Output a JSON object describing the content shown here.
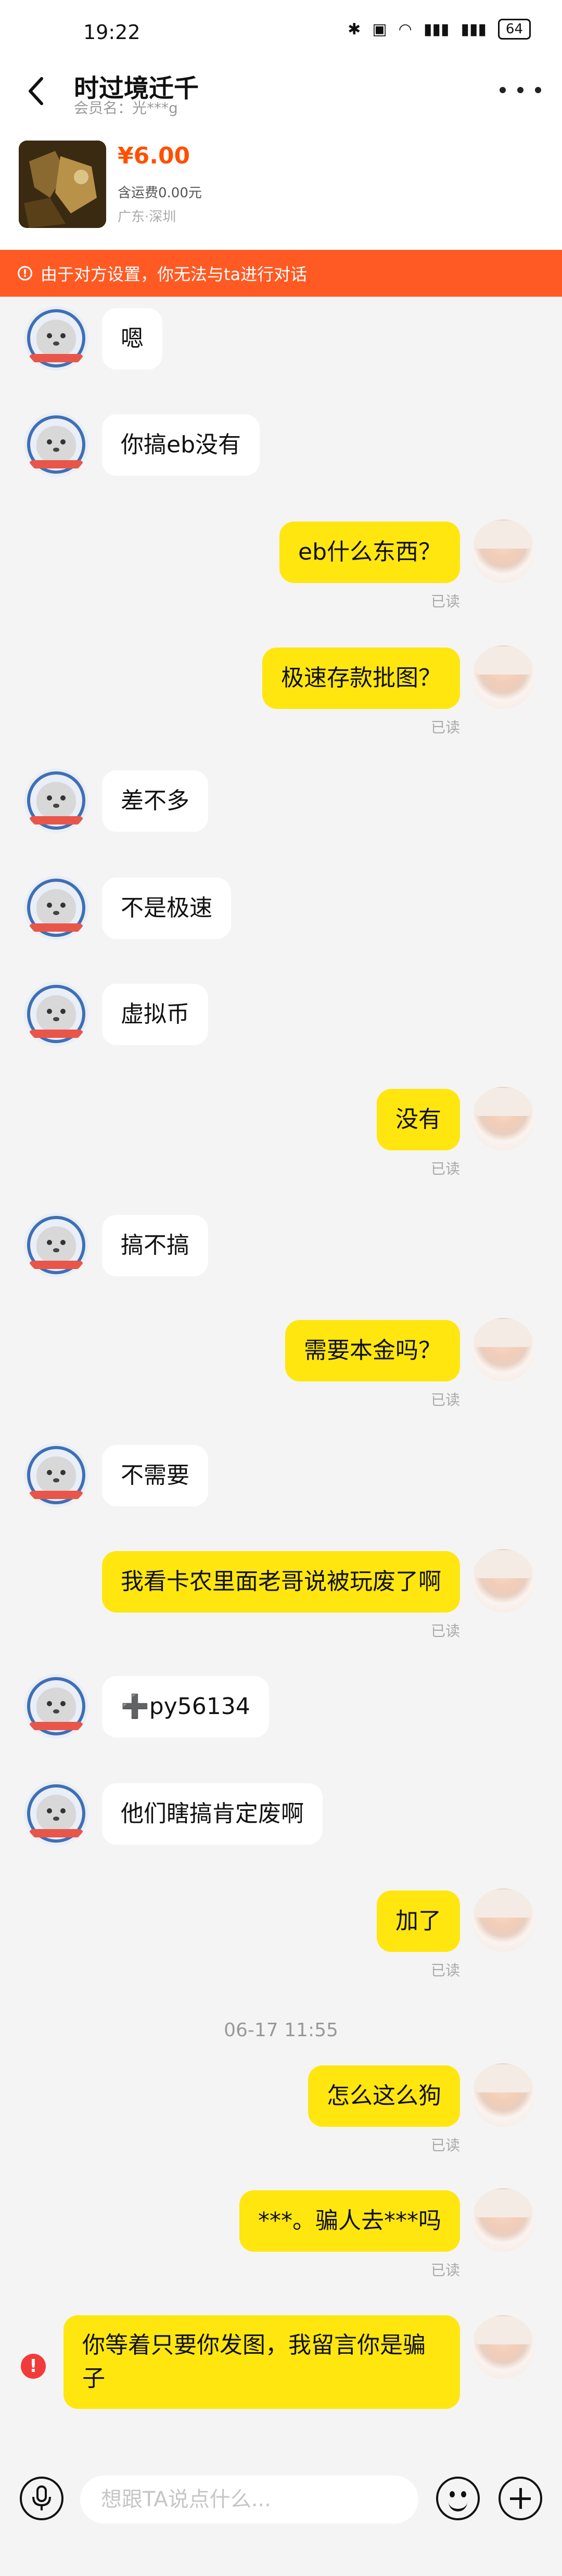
{
  "status_bar": {
    "time": "19:22",
    "icons": [
      "bluetooth-icon",
      "nfc-icon",
      "wifi-icon",
      "signal-5g-icon",
      "signal-4g-icon"
    ],
    "battery": "64"
  },
  "header": {
    "seller_name": "时过境迁千",
    "member_label": "会员名：光***g"
  },
  "product": {
    "price": "¥6.00",
    "shipping": "含运费0.00元",
    "location": "广东·深圳"
  },
  "notice": {
    "text": "由于对方设置，你无法与ta进行对话",
    "color": "#ff5a24"
  },
  "messages": [
    {
      "side": "left",
      "text": "嗯"
    },
    {
      "side": "left",
      "text": "你搞eb没有"
    },
    {
      "side": "right",
      "text": "eb什么东西？",
      "status": "已读"
    },
    {
      "side": "right",
      "text": "极速存款批图？",
      "status": "已读"
    },
    {
      "side": "left",
      "text": "差不多"
    },
    {
      "side": "left",
      "text": "不是极速"
    },
    {
      "side": "left",
      "text": "虚拟币"
    },
    {
      "side": "right",
      "text": "没有",
      "status": "已读"
    },
    {
      "side": "left",
      "text": "搞不搞"
    },
    {
      "side": "right",
      "text": "需要本金吗？",
      "status": "已读"
    },
    {
      "side": "left",
      "text": "不需要"
    },
    {
      "side": "right",
      "text": "我看卡农里面老哥说被玩废了啊",
      "status": "已读"
    },
    {
      "side": "left",
      "text": "➕py56134"
    },
    {
      "side": "left",
      "text": "他们瞎搞肯定废啊"
    },
    {
      "side": "right",
      "text": "加了",
      "status": "已读"
    },
    {
      "type": "timestamp",
      "text": "06-17 11:55"
    },
    {
      "side": "right",
      "text": "怎么这么狗",
      "status": "已读"
    },
    {
      "side": "right",
      "text": "***。骗人去***吗",
      "status": "已读"
    },
    {
      "side": "right",
      "text": "你等着只要你发图，我留言你是骗子",
      "failed": true
    }
  ],
  "input": {
    "placeholder": "想跟TA说点什么..."
  },
  "colors": {
    "accent": "#ff5000",
    "bubble_self": "#ffe60f",
    "bubble_other": "#ffffff",
    "error": "#f23a3a"
  }
}
